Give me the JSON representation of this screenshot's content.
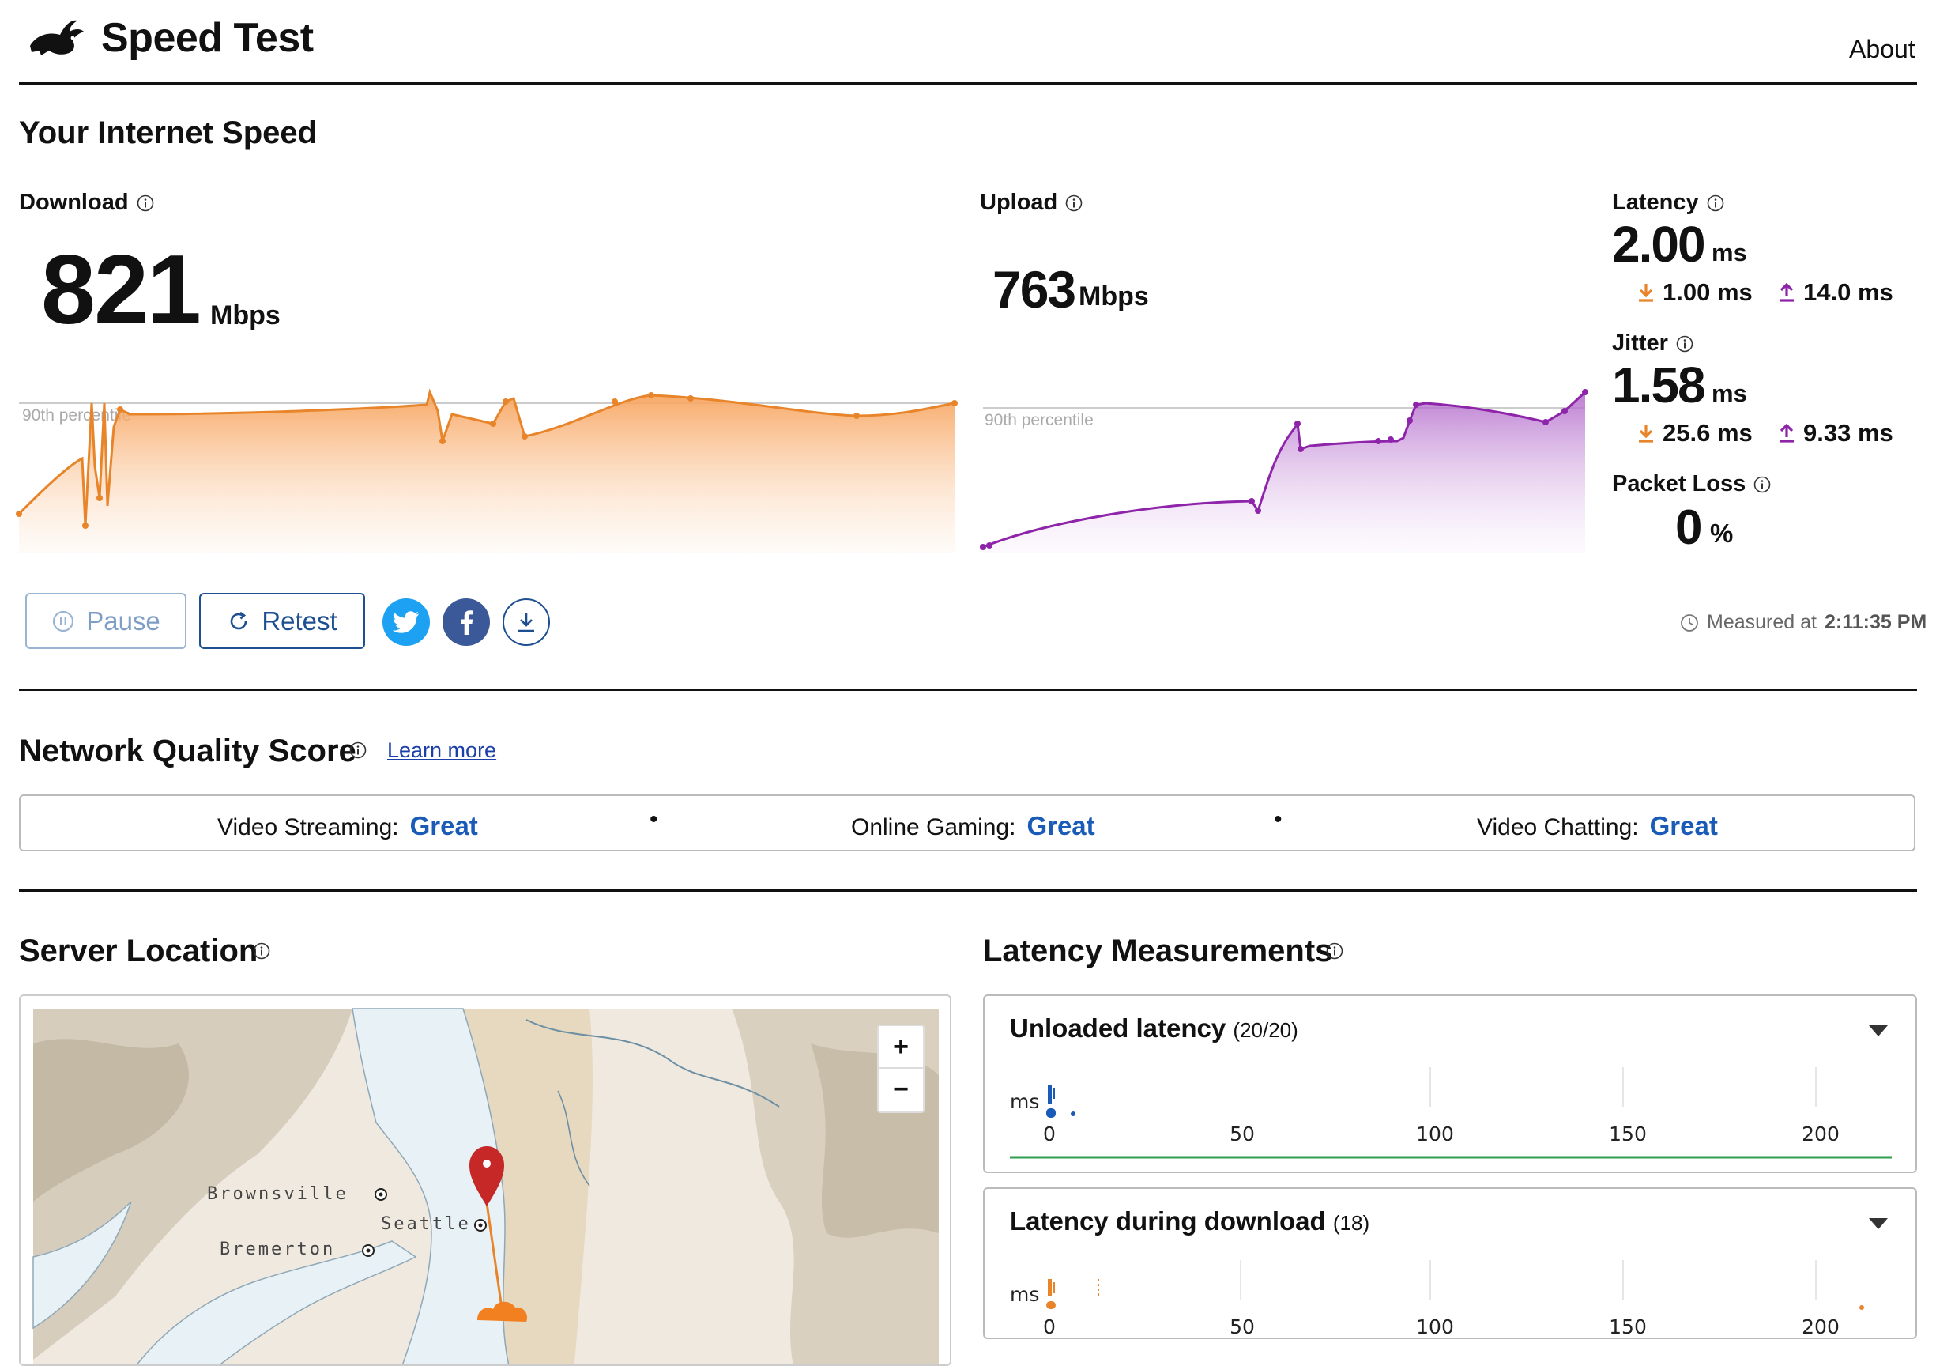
{
  "header": {
    "title": "Speed Test",
    "about_label": "About"
  },
  "speed_section": {
    "title": "Your Internet Speed",
    "download": {
      "label": "Download",
      "value": "821",
      "unit": "Mbps",
      "percentile_label": "90th percentile"
    },
    "upload": {
      "label": "Upload",
      "value": "763",
      "unit": "Mbps",
      "percentile_label": "90th percentile"
    },
    "latency": {
      "label": "Latency",
      "value": "2.00",
      "unit": "ms",
      "down": "1.00 ms",
      "up": "14.0 ms"
    },
    "jitter": {
      "label": "Jitter",
      "value": "1.58",
      "unit": "ms",
      "down": "25.6 ms",
      "up": "9.33 ms"
    },
    "packet_loss": {
      "label": "Packet Loss",
      "value": "0",
      "unit": "%"
    },
    "buttons": {
      "pause": "Pause",
      "retest": "Retest"
    },
    "measured": {
      "prefix": "Measured at",
      "time": "2:11:35 PM"
    }
  },
  "network_quality": {
    "title": "Network Quality Score",
    "learn_more": "Learn more",
    "items": [
      {
        "label": "Video Streaming:",
        "value": "Great"
      },
      {
        "label": "Online Gaming:",
        "value": "Great"
      },
      {
        "label": "Video Chatting:",
        "value": "Great"
      }
    ],
    "separator": "•"
  },
  "server_location": {
    "title": "Server Location",
    "cities": [
      "Brownsville",
      "Seattle",
      "Bremerton"
    ],
    "zoom_in": "+",
    "zoom_out": "−"
  },
  "latency_measurements": {
    "title": "Latency Measurements",
    "panels": [
      {
        "title": "Unloaded latency",
        "count": "(20/20)",
        "unit": "ms",
        "ticks": [
          "0",
          "50",
          "100",
          "150",
          "200"
        ]
      },
      {
        "title": "Latency during download",
        "count": "(18)",
        "unit": "ms",
        "ticks": [
          "0",
          "50",
          "100",
          "150",
          "200"
        ]
      }
    ]
  },
  "colors": {
    "download": "#e8852a",
    "upload": "#8e24aa",
    "accent_blue": "#1a5bb8",
    "twitter": "#1da1f2",
    "facebook": "#3b5998",
    "unloaded_line": "#2e9e4f"
  },
  "icons": [
    "rabbit-logo-icon",
    "info-icon",
    "download-arrow-icon",
    "upload-arrow-icon",
    "pause-icon",
    "retest-icon",
    "twitter-icon",
    "facebook-icon",
    "download-results-icon",
    "clock-icon",
    "map-pin-icon",
    "chevron-down-icon"
  ]
}
